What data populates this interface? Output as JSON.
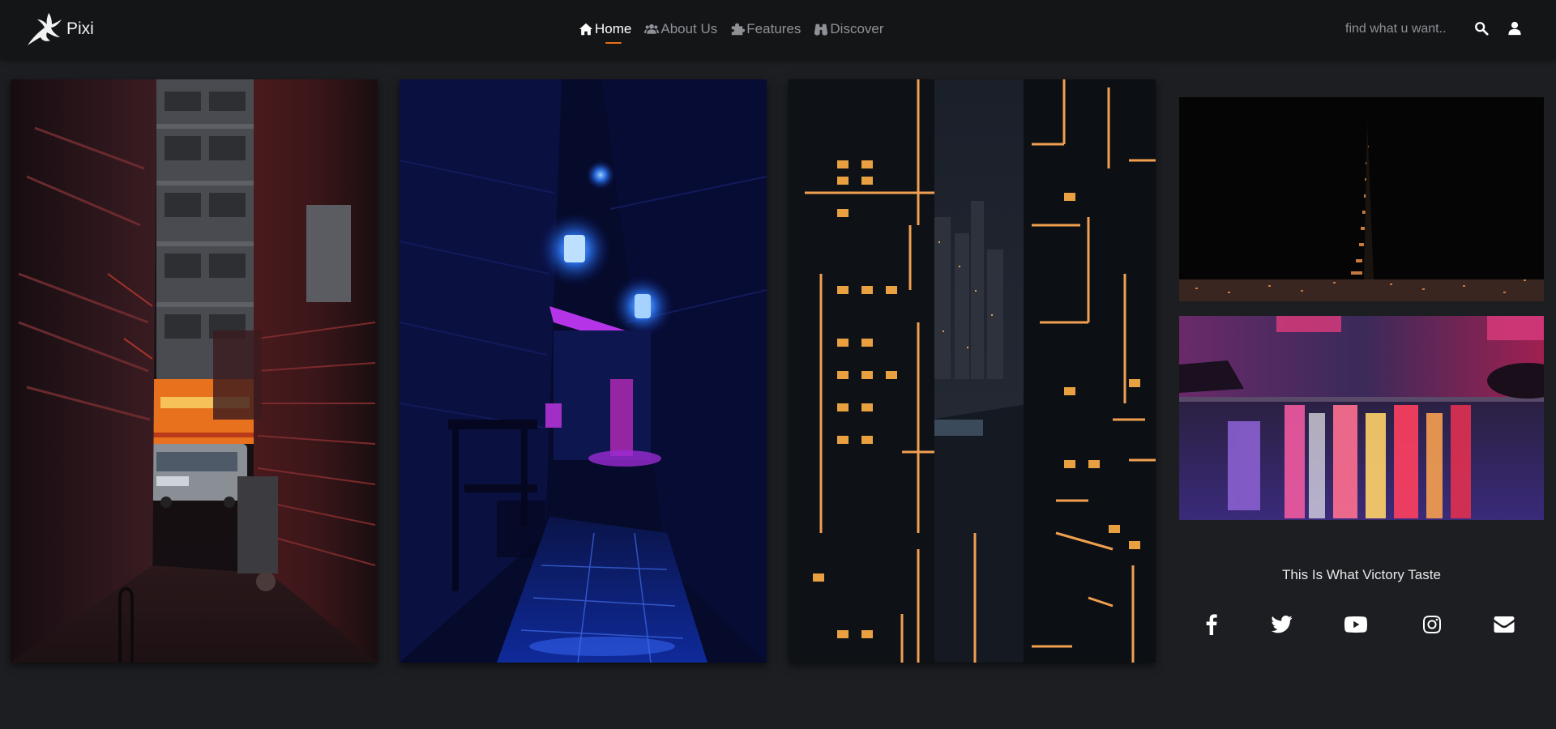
{
  "brand": {
    "name": "Pixi"
  },
  "nav": {
    "items": [
      {
        "label": "Home",
        "icon": "home-icon",
        "active": true
      },
      {
        "label": "About Us",
        "icon": "users-icon",
        "active": false
      },
      {
        "label": "Features",
        "icon": "puzzle-icon",
        "active": false
      },
      {
        "label": "Discover",
        "icon": "binoculars-icon",
        "active": false
      }
    ]
  },
  "search": {
    "placeholder": "find what u want.."
  },
  "gallery": {
    "images": [
      {
        "scene": "red-neon-alley"
      },
      {
        "scene": "blue-lantern-alley"
      },
      {
        "scene": "night-skyscrapers"
      }
    ],
    "side_images": [
      {
        "scene": "dark-city-tower"
      },
      {
        "scene": "neon-wet-street"
      }
    ]
  },
  "sidebar": {
    "tagline": "This Is What Victory Taste",
    "socials": [
      "facebook-icon",
      "twitter-icon",
      "youtube-icon",
      "instagram-icon",
      "envelope-icon"
    ]
  },
  "colors": {
    "background": "#1c1e22",
    "header": "#141517",
    "accent": "#e8701a",
    "nav_inactive": "#8e9196",
    "nav_active": "#ffffff"
  }
}
